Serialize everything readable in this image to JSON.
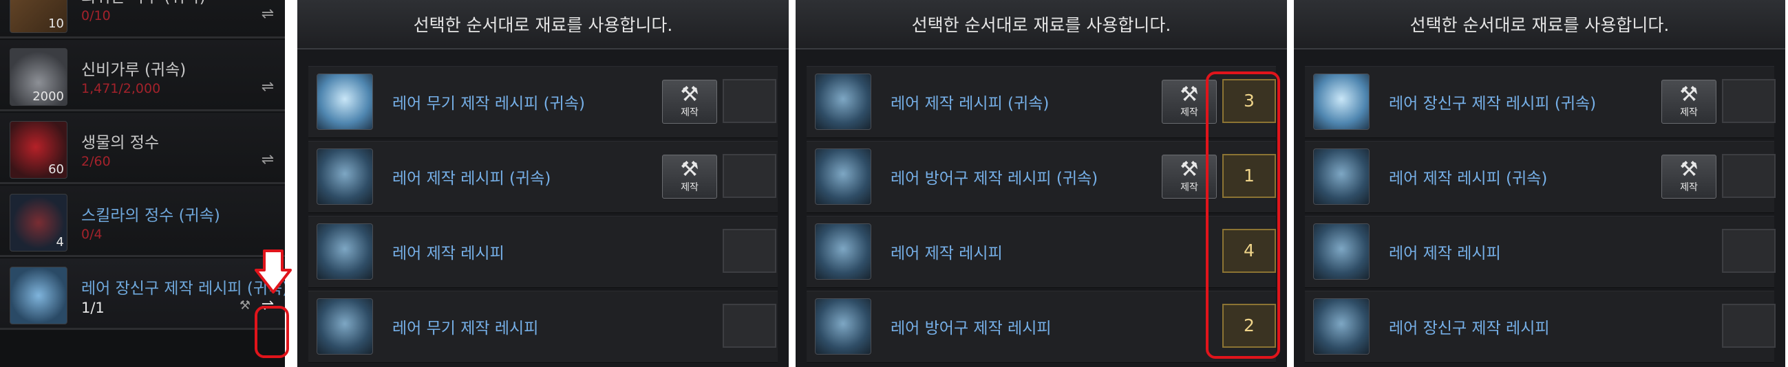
{
  "materials": {
    "items": [
      {
        "name": "희귀한 나무 (귀속)",
        "count": "0/10",
        "qty": "10"
      },
      {
        "name": "신비가루 (귀속)",
        "count": "1,471/2,000",
        "qty": "2000"
      },
      {
        "name": "생물의 정수",
        "count": "2/60",
        "qty": "60"
      },
      {
        "name": "스킬라의 정수 (귀속)",
        "count": "0/4",
        "qty": "4"
      },
      {
        "name": "레어 장신구 제작 레시피 (귀속)",
        "count": "1/1",
        "qty": ""
      }
    ]
  },
  "panel1": {
    "header": "선택한 순서대로 재료를 사용합니다.",
    "rows": [
      {
        "name": "레어 무기 제작 레시피 (귀속)",
        "craft_label": "제작",
        "slot": ""
      },
      {
        "name": "레어 제작 레시피 (귀속)",
        "craft_label": "제작",
        "slot": ""
      },
      {
        "name": "레어 제작 레시피",
        "slot": ""
      },
      {
        "name": "레어 무기 제작 레시피",
        "slot": ""
      }
    ]
  },
  "panel2": {
    "header": "선택한 순서대로 재료를 사용합니다.",
    "rows": [
      {
        "name": "레어 제작 레시피 (귀속)",
        "craft_label": "제작",
        "slot": "3"
      },
      {
        "name": "레어 방어구 제작 레시피 (귀속)",
        "craft_label": "제작",
        "slot": "1"
      },
      {
        "name": "레어 제작 레시피",
        "slot": "4"
      },
      {
        "name": "레어 방어구 제작 레시피",
        "slot": "2"
      }
    ]
  },
  "panel3": {
    "header": "선택한 순서대로 재료를 사용합니다.",
    "rows": [
      {
        "name": "레어 장신구 제작 레시피 (귀속)",
        "craft_label": "제작",
        "slot": ""
      },
      {
        "name": "레어 제작 레시피 (귀속)",
        "craft_label": "제작",
        "slot": ""
      },
      {
        "name": "레어 제작 레시피",
        "slot": ""
      },
      {
        "name": "레어 장신구 제작 레시피",
        "slot": ""
      }
    ]
  },
  "icons": {
    "swap": "swap-arrows-icon",
    "craft": "hammer-pickaxe-icon",
    "annotation": "red-down-arrow"
  },
  "colors": {
    "recipe_name": "#76b0e8",
    "count_red": "#a3222b",
    "highlight": "#e0141b",
    "order_number": "#f0d58a"
  }
}
